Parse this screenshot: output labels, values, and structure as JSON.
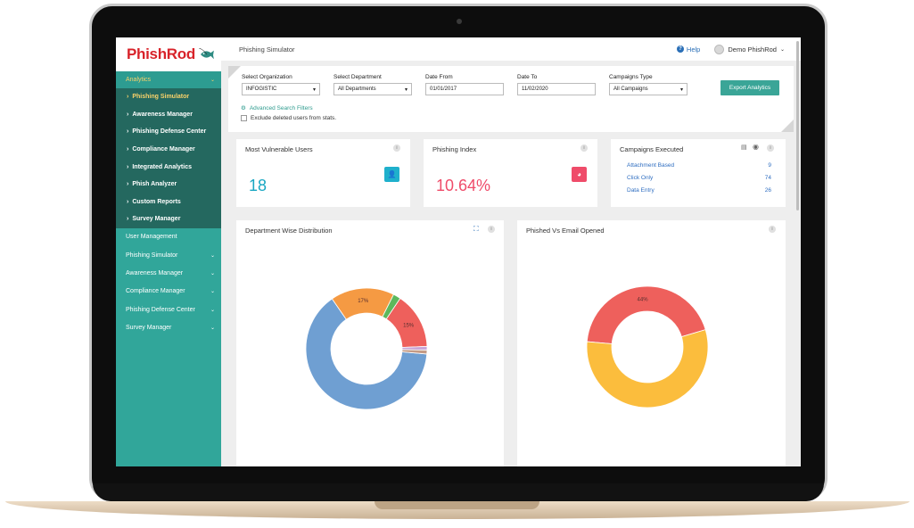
{
  "brand": {
    "logo_text": "PhishRod",
    "primary_color": "#31a69a",
    "accent_color": "#f9d26a"
  },
  "sidebar": {
    "analytics_label": "Analytics",
    "sub_items": [
      {
        "label": "Phishing Simulator"
      },
      {
        "label": "Awareness Manager"
      },
      {
        "label": "Phishing Defense Center"
      },
      {
        "label": "Compliance Manager"
      },
      {
        "label": "Integrated Analytics"
      },
      {
        "label": "Phish Analyzer"
      },
      {
        "label": "Custom Reports"
      },
      {
        "label": "Survey Manager"
      }
    ],
    "main_items": [
      {
        "label": "User Management"
      },
      {
        "label": "Phishing Simulator"
      },
      {
        "label": "Awareness Manager"
      },
      {
        "label": "Compliance Manager"
      },
      {
        "label": "Phishing Defense Center"
      },
      {
        "label": "Survey Manager"
      }
    ]
  },
  "header": {
    "page_title": "Phishing Simulator",
    "help_label": "Help",
    "user_name": "Demo PhishRod"
  },
  "filters": {
    "org_label": "Select Organization",
    "org_value": "INFOGISTIC",
    "dept_label": "Select Department",
    "dept_value": "All Departments",
    "date_from_label": "Date From",
    "date_from_value": "01/01/2017",
    "date_to_label": "Date To",
    "date_to_value": "11/02/2020",
    "camp_type_label": "Campaigns Type",
    "camp_type_value": "All Campaigns",
    "export_label": "Export Analytics",
    "advanced_label": "Advanced Search Filters",
    "exclude_label": "Exclude deleted users from stats."
  },
  "cards": {
    "vulnerable_title": "Most Vulnerable Users",
    "vulnerable_value": "18",
    "index_title": "Phishing Index",
    "index_value": "10.64%",
    "campaigns_title": "Campaigns Executed",
    "campaigns": [
      {
        "label": "Attachment Based",
        "value": "9"
      },
      {
        "label": "Click Only",
        "value": "74"
      },
      {
        "label": "Data Entry",
        "value": "26"
      }
    ]
  },
  "charts_text": {
    "dept_title": "Department Wise Distribution",
    "phished_title": "Phished Vs Email Opened"
  },
  "chart_data": [
    {
      "type": "pie",
      "title": "Department Wise Distribution",
      "slices": [
        {
          "value": 64,
          "color": "#6f9fd2"
        },
        {
          "value": 17,
          "color": "#f59a43",
          "label": "17%"
        },
        {
          "value": 2,
          "color": "#5cb85c"
        },
        {
          "value": 15,
          "color": "#ee605c",
          "label": "15%"
        },
        {
          "value": 1,
          "color": "#c9a7d8"
        },
        {
          "value": 1,
          "color": "#c49b86"
        }
      ]
    },
    {
      "type": "pie",
      "title": "Phished Vs Email Opened",
      "slices": [
        {
          "value": 44,
          "color": "#ee605c",
          "label": "44%"
        },
        {
          "value": 56,
          "color": "#fbbd3d"
        }
      ]
    }
  ]
}
